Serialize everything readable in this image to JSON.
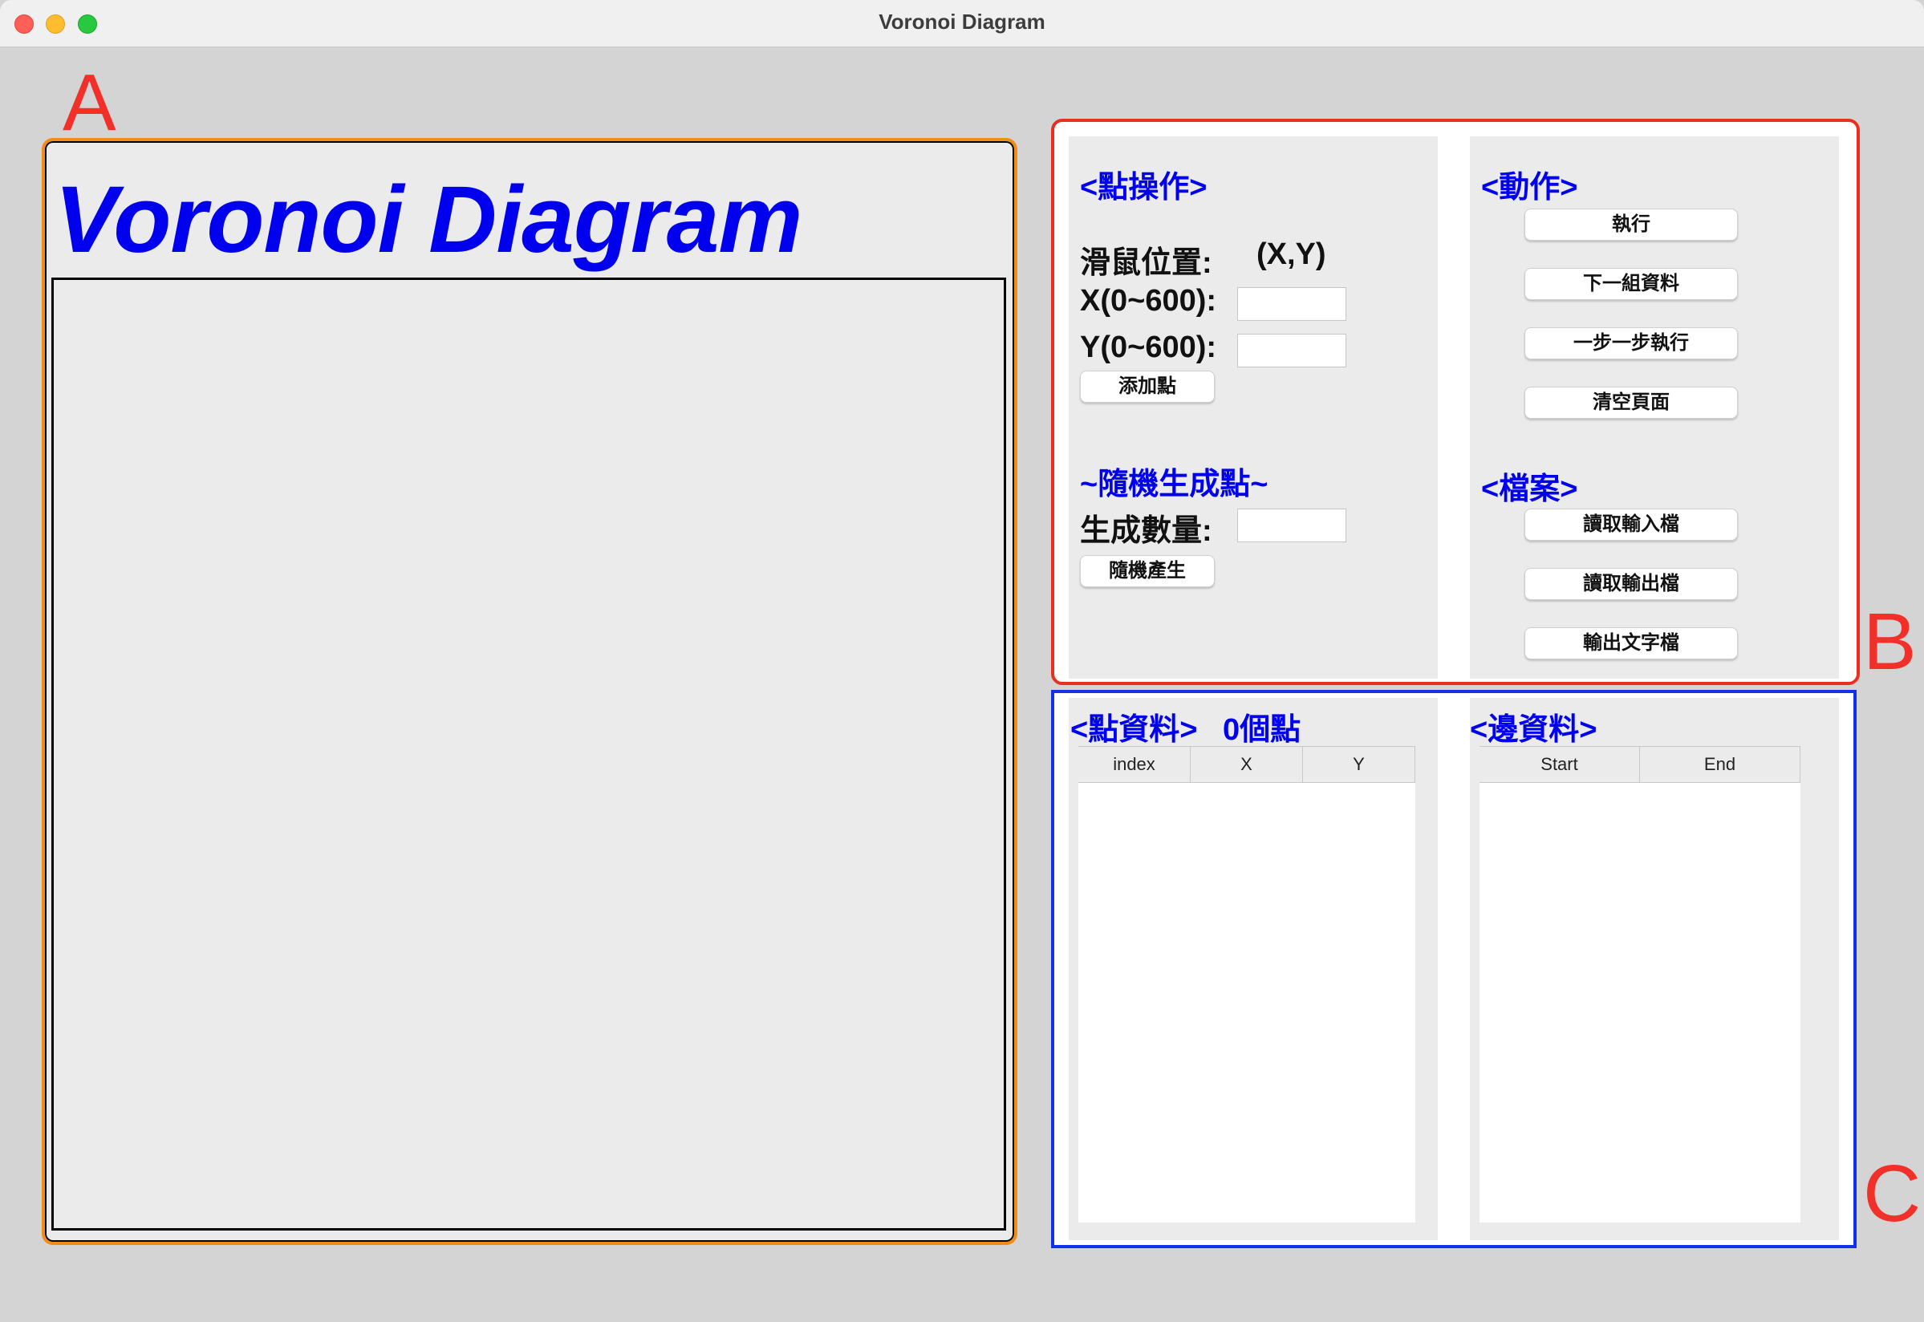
{
  "window": {
    "title": "Voronoi Diagram"
  },
  "annotations": {
    "a": "A",
    "b": "B",
    "c": "C"
  },
  "canvas_panel": {
    "title": "Voronoi Diagram"
  },
  "point_ops": {
    "title": "<點操作>",
    "mouse_label": "滑鼠位置:",
    "mouse_value": "(X,Y)",
    "x_label": "X(0~600):",
    "x_value": "",
    "y_label": "Y(0~600):",
    "y_value": "",
    "add_button": "添加點",
    "random_title": "~隨機生成點~",
    "count_label": "生成數量:",
    "count_value": "",
    "random_button": "隨機產生"
  },
  "actions": {
    "title": "<動作>",
    "run": "執行",
    "next": "下一組資料",
    "step": "一步一步執行",
    "clear": "清空頁面"
  },
  "files": {
    "title": "<檔案>",
    "read_input": "讀取輸入檔",
    "read_output": "讀取輸出檔",
    "export_text": "輸出文字檔"
  },
  "points_table": {
    "title": "<點資料>",
    "count": "0個點",
    "columns": [
      "index",
      "X",
      "Y"
    ],
    "rows": []
  },
  "edges_table": {
    "title": "<邊資料>",
    "columns": [
      "Start",
      "End"
    ],
    "rows": []
  },
  "colors": {
    "accent_blue": "#0000ee",
    "annotation_red": "#f2302a",
    "panel_a_border": "#f28c18",
    "panel_b_border": "#ea2f22",
    "panel_c_border": "#1230e6"
  }
}
